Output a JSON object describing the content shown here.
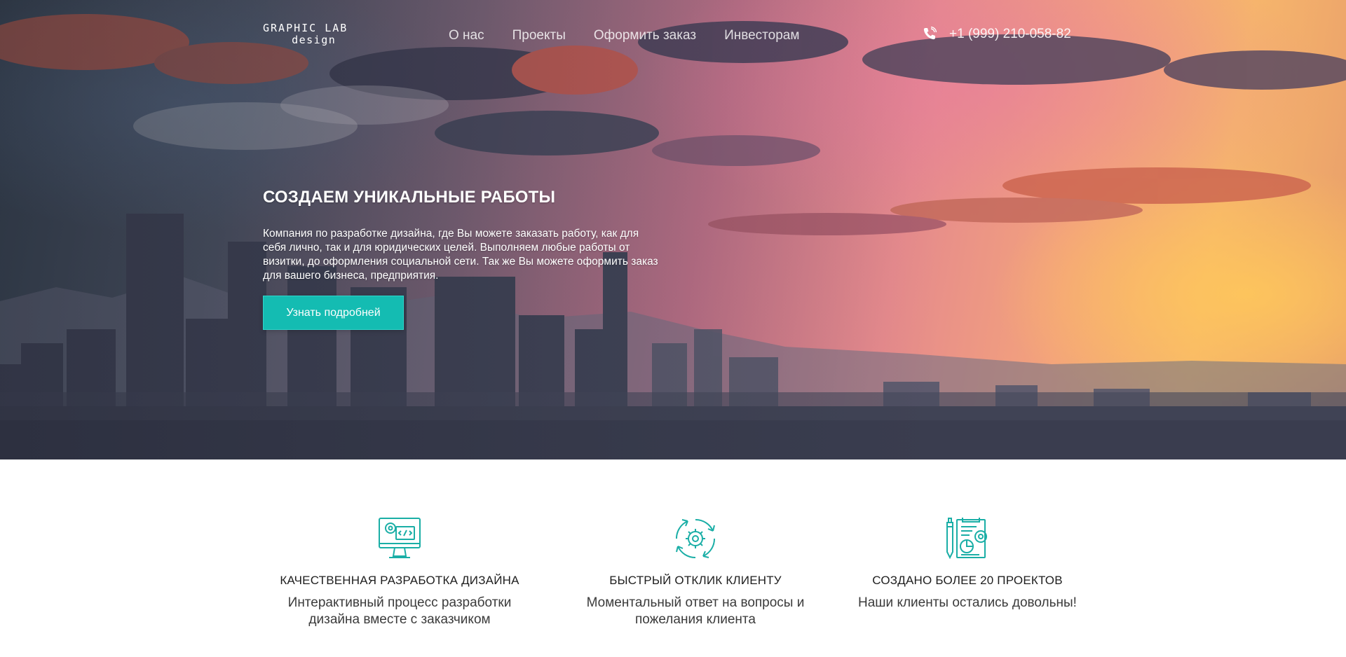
{
  "header": {
    "logo_top": "GRAPHIC LAB",
    "logo_bottom": "design",
    "nav": [
      {
        "label": "О нас"
      },
      {
        "label": "Проекты"
      },
      {
        "label": "Оформить заказ"
      },
      {
        "label": "Инвесторам"
      }
    ],
    "phone": "+1 (999) 210-058-82",
    "phone_icon": "phone-icon"
  },
  "hero": {
    "title": "СОЗДАЕМ УНИКАЛЬНЫЕ РАБОТЫ",
    "text": "Компания по разработке дизайна, где Вы можете заказать работу, как для себя лично, так и для юридических целей. Выполняем любые работы от визитки, до оформления социальной сети. Так же Вы можете оформить заказ для вашего бизнеса, предприятия.",
    "button_label": "Узнать подробней"
  },
  "features": [
    {
      "icon": "design-monitor-icon",
      "title": "КАЧЕСТВЕННАЯ РАЗРАБОТКА ДИЗАЙНА",
      "text": "Интерактивный процесс разработки дизайна вместе с заказчиком"
    },
    {
      "icon": "gear-cycle-icon",
      "title": "БЫСТРЫЙ ОТКЛИК КЛИЕНТУ",
      "text": "Моментальный ответ на вопросы и пожелания клиента"
    },
    {
      "icon": "project-document-icon",
      "title": "СОЗДАНО БОЛЕЕ 20 ПРОЕКТОВ",
      "text": "Наши клиенты остались довольны!"
    }
  ],
  "colors": {
    "accent": "#14bcb2",
    "icon": "#1aaea6"
  }
}
